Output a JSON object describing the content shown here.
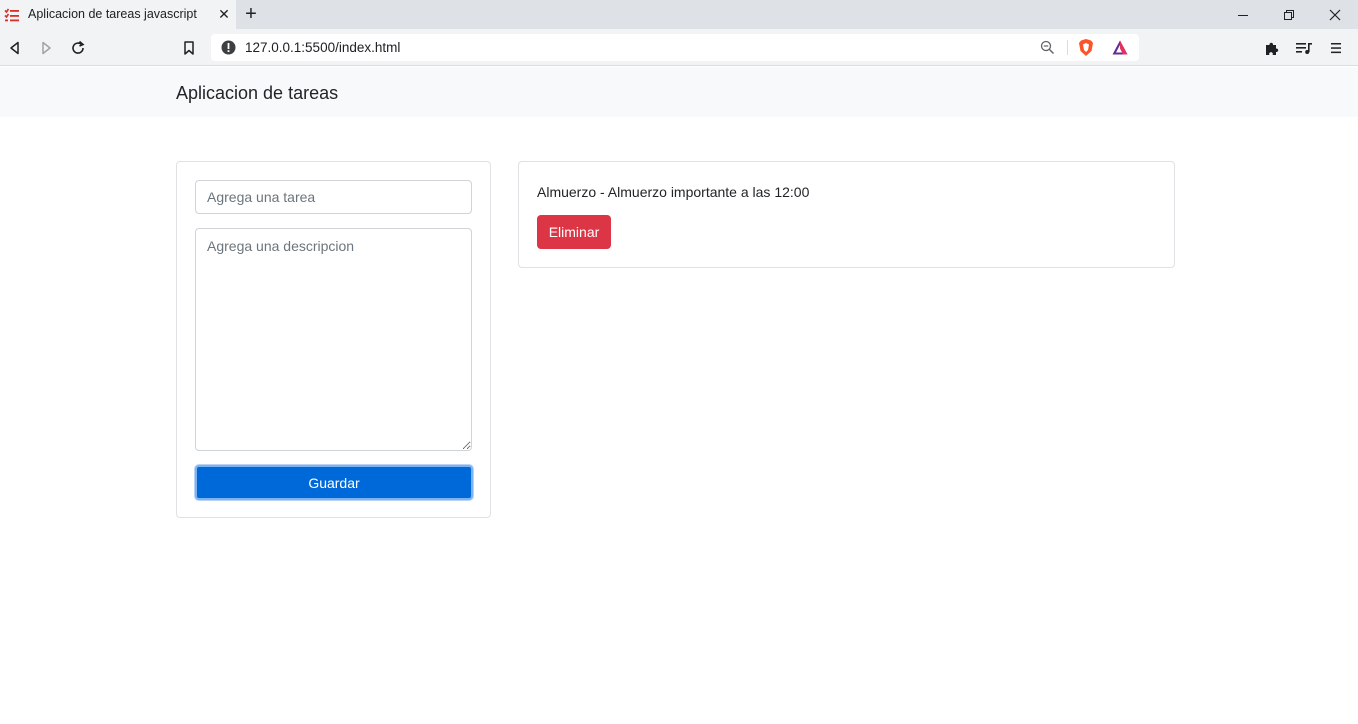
{
  "browser": {
    "tab_title": "Aplicacion de tareas javascript",
    "tab_close": "✕",
    "new_tab": "+",
    "url": "127.0.0.1:5500/index.html"
  },
  "navbar": {
    "brand": "Aplicacion de tareas"
  },
  "form": {
    "title_placeholder": "Agrega una tarea",
    "description_placeholder": "Agrega una descripcion",
    "save_label": "Guardar"
  },
  "tasks": [
    {
      "text": "Almuerzo - Almuerzo importante a las 12:00",
      "delete_label": "Eliminar"
    }
  ],
  "colors": {
    "primary": "#0069d9",
    "danger": "#dc3545",
    "navbar_bg": "#f8f9fa"
  }
}
